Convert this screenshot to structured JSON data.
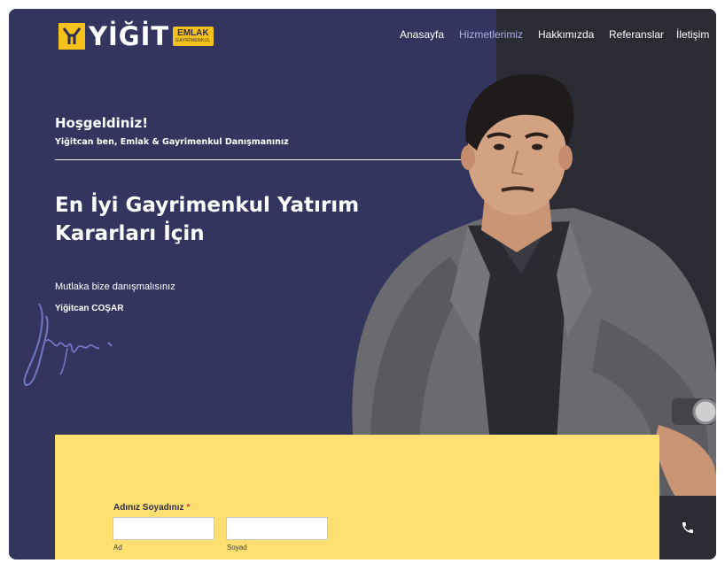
{
  "brand": {
    "logo_word": "YİĞİT",
    "badge_line1": "EMLAK",
    "badge_line2": "GAYRİMENKUL"
  },
  "nav": {
    "items": [
      {
        "label": "Anasayfa",
        "active": false
      },
      {
        "label": "Hizmetlerimiz",
        "active": true
      },
      {
        "label": "Hakkımızda",
        "active": false
      },
      {
        "label": "Referanslar",
        "active": false
      },
      {
        "label": "İletişim",
        "active": false
      }
    ]
  },
  "hero": {
    "welcome": "Hoşgeldiniz!",
    "welcome_sub": "Yiğitcan ben, Emlak & Gayrimenkul Danışmanınız",
    "headline": "En İyi Gayrimenkul Yatırım Kararları İçin",
    "advice": "Mutlaka bize danışmalısınız",
    "signer": "Yiğitcan COŞAR"
  },
  "form": {
    "name_label": "Adınız Soyadınız",
    "required_mark": "*",
    "first_name_value": "",
    "last_name_value": "",
    "first_sub_label": "Ad",
    "last_sub_label": "Soyad"
  },
  "icons": {
    "phone": "phone-icon",
    "signature": "signature-icon"
  },
  "colors": {
    "hero_bg": "#34355f",
    "dark_panel": "#2b2b33",
    "accent_yellow": "#fde070",
    "brand_yellow": "#f4c21a",
    "nav_active": "#a9b3e6"
  }
}
